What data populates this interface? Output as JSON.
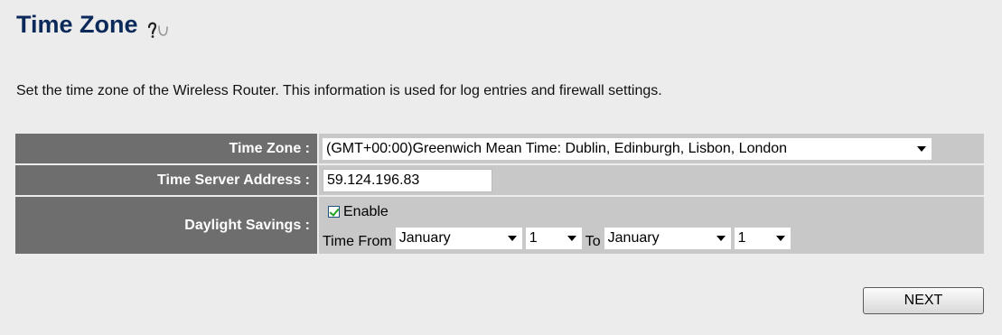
{
  "page": {
    "title": "Time Zone",
    "description": "Set the time zone of the Wireless Router. This information is used for log entries and firewall settings.",
    "help_icon": "help-icon"
  },
  "settings": {
    "time_zone": {
      "label": "Time Zone :",
      "selected": "(GMT+00:00)Greenwich Mean Time: Dublin, Edinburgh, Lisbon, London"
    },
    "time_server": {
      "label": "Time Server Address :",
      "value": "59.124.196.83"
    },
    "daylight_savings": {
      "label": "Daylight Savings :",
      "enable_label": "Enable",
      "enabled": true,
      "time_from_label": "Time From",
      "from_month": "January",
      "from_day": "1",
      "to_label": "To",
      "to_month": "January",
      "to_day": "1"
    }
  },
  "buttons": {
    "next": "NEXT"
  },
  "colors": {
    "background": "#ececec",
    "title": "#0b2a5a",
    "label_cell": "#6e6e6e",
    "value_cell": "#c8c8c8"
  }
}
